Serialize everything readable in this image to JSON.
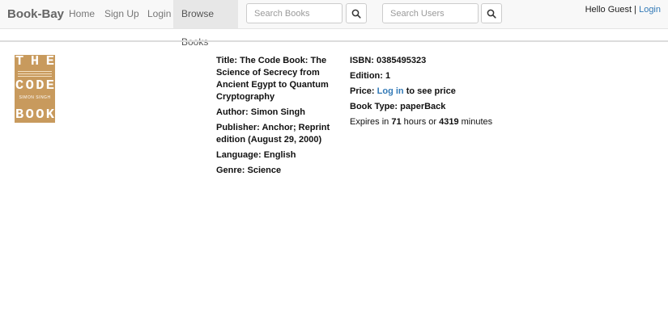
{
  "navbar": {
    "brand": "Book-Bay",
    "links": [
      {
        "label": "Home"
      },
      {
        "label": "Sign Up"
      },
      {
        "label": "Login"
      },
      {
        "label": "Browse Books"
      }
    ],
    "search_books_placeholder": "Search Books",
    "search_users_placeholder": "Search Users",
    "greeting_text": "Hello Guest",
    "separator": "|",
    "login_link": "Login"
  },
  "book": {
    "cover_title_letters": [
      "T",
      "H",
      "E",
      "C",
      "O",
      "D",
      "E",
      "B",
      "O",
      "O",
      "K"
    ],
    "cover_author": "SIMON SINGH",
    "title_label": "Title:",
    "title": "The Code Book: The Science of Secrecy from Ancient Egypt to Quantum Cryptography",
    "author_label": "Author:",
    "author": "Simon Singh",
    "publisher_label": "Publisher:",
    "publisher": "Anchor; Reprint edition (August 29, 2000)",
    "language_label": "Language:",
    "language": "English",
    "genre_label": "Genre:",
    "genre": "Science",
    "isbn_label": "ISBN:",
    "isbn": "0385495323",
    "edition_label": "Edition:",
    "edition": "1",
    "price_label": "Price:",
    "price_link": "Log in",
    "price_suffix": "to see price",
    "booktype_label": "Book Type:",
    "booktype": "paperBack",
    "expires_prefix": "Expires in",
    "expires_hours": "71",
    "expires_mid": "hours or",
    "expires_minutes": "4319",
    "expires_suffix": "minutes"
  }
}
